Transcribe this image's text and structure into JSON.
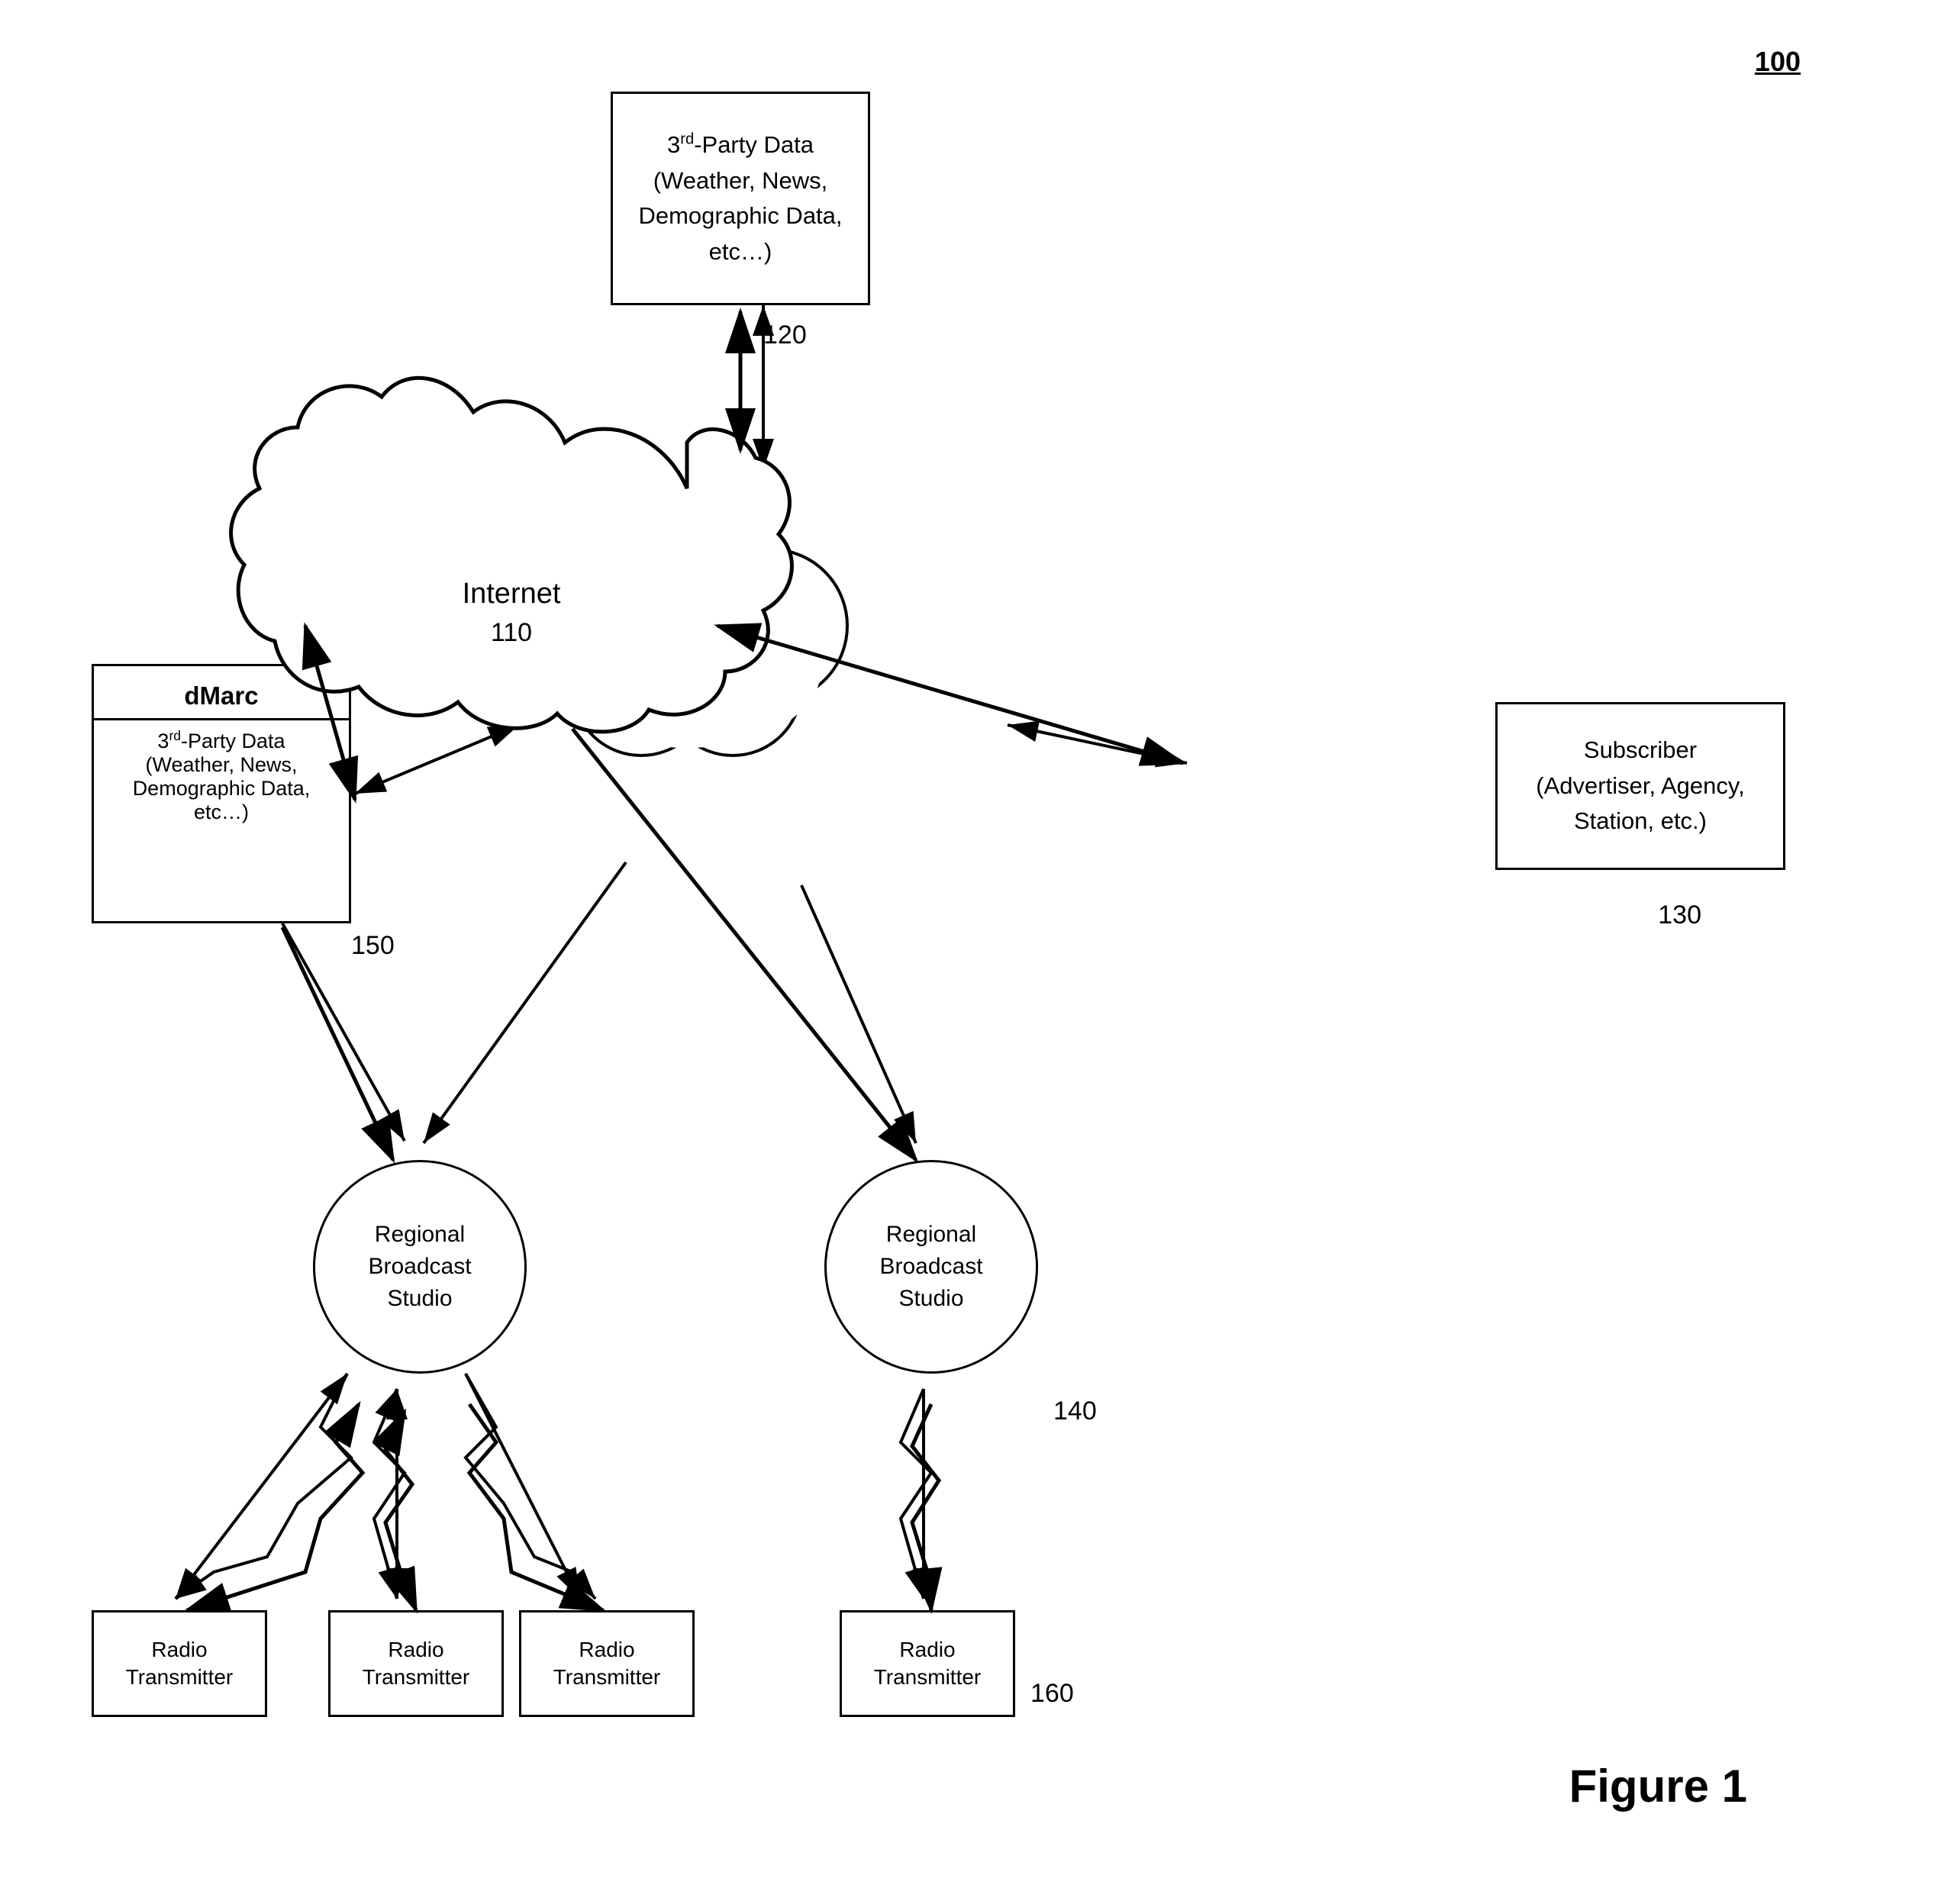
{
  "diagram": {
    "title": "100",
    "figure_label": "Figure 1",
    "nodes": {
      "third_party_data_top": {
        "label_line1": "3",
        "label_sup": "rd",
        "label_line2": "-Party Data",
        "label_line3": "(Weather, News,",
        "label_line4": "Demographic Data,",
        "label_line5": "etc…)"
      },
      "internet": {
        "label": "Internet",
        "number": "110"
      },
      "dmarc": {
        "top_label": "dMarc",
        "bottom_line1": "3",
        "bottom_sup": "rd",
        "bottom_line2": "-Party Data",
        "bottom_line3": "(Weather, News,",
        "bottom_line4": "Demographic Data,",
        "bottom_line5": "etc…)"
      },
      "subscriber": {
        "label_line1": "Subscriber",
        "label_line2": "(Advertiser, Agency,",
        "label_line3": "Station, etc.)"
      },
      "regional_studio_left": {
        "label": "Regional\nBroadcast\nStudio"
      },
      "regional_studio_right": {
        "label": "Regional\nBroadcast\nStudio"
      },
      "radio_transmitter_1": {
        "label": "Radio\nTransmitter"
      },
      "radio_transmitter_2": {
        "label": "Radio\nTransmitter"
      },
      "radio_transmitter_3": {
        "label": "Radio\nTransmitter"
      },
      "radio_transmitter_4": {
        "label": "Radio\nTransmitter"
      }
    },
    "labels": {
      "n120": "120",
      "n130": "130",
      "n140": "140",
      "n150": "150",
      "n160": "160"
    }
  }
}
